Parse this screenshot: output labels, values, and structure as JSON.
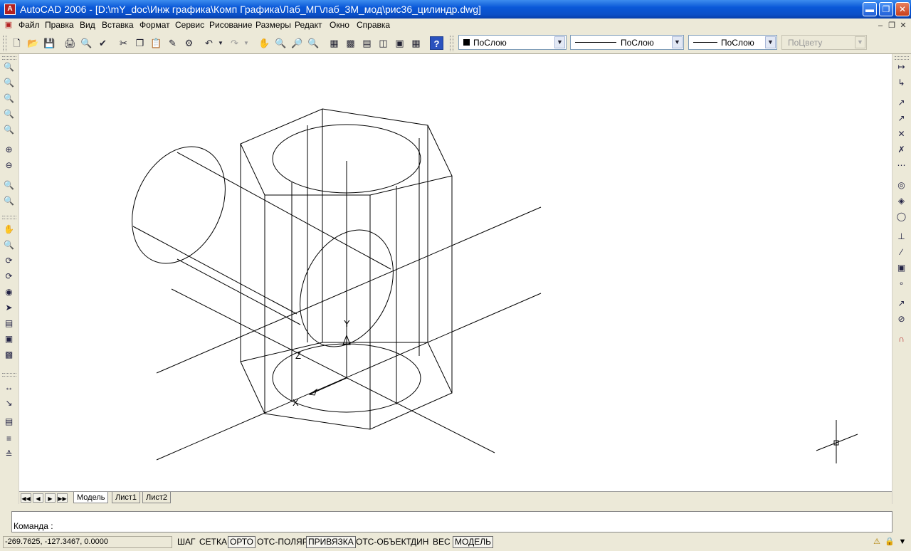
{
  "window": {
    "title": "AutoCAD 2006 - [D:\\mY_doc\\Инж графика\\Комп Графика\\Лаб_МГ\\лаб_3М_мод\\рис36_цилиндр.dwg]",
    "app_icon": "autocad-logo-icon",
    "controls": {
      "minimize": "minimize-icon",
      "restore": "restore-icon",
      "close": "close-icon"
    }
  },
  "menu": [
    {
      "label": "Файл"
    },
    {
      "label": "Правка"
    },
    {
      "label": "Вид"
    },
    {
      "label": "Вставка"
    },
    {
      "label": "Формат"
    },
    {
      "label": "Сервис"
    },
    {
      "label": "Рисование"
    },
    {
      "label": "Размеры"
    },
    {
      "label": "Редакт"
    },
    {
      "label": "Окно"
    },
    {
      "label": "Справка"
    }
  ],
  "toolbar": {
    "layer_color_select": "ПоСлою",
    "linetype_select": "ПоСлою",
    "lineweight_select": "ПоСлою",
    "plotstyle_select": "ПоЦвету"
  },
  "layout_tabs": [
    {
      "label": "Модель",
      "active": true
    },
    {
      "label": "Лист1",
      "active": false
    },
    {
      "label": "Лист2",
      "active": false
    }
  ],
  "command": {
    "prompt": "Команда :"
  },
  "status": {
    "coords": "-269.7625, -127.3467, 0.0000",
    "toggles": [
      {
        "label": "ШАГ",
        "on": false
      },
      {
        "label": "СЕТКА",
        "on": false
      },
      {
        "label": "ОРТО",
        "on": true
      },
      {
        "label": "ОТС-ПОЛЯР",
        "on": false
      },
      {
        "label": "ПРИВЯЗКА",
        "on": true
      },
      {
        "label": "ОТС-ОБЪЕКТ",
        "on": false
      },
      {
        "label": "ДИН",
        "on": false
      },
      {
        "label": "ВЕС",
        "on": false
      },
      {
        "label": "МОДЕЛЬ",
        "on": true
      }
    ]
  },
  "ucs": {
    "x": "X",
    "y": "Y",
    "z": "Z"
  }
}
